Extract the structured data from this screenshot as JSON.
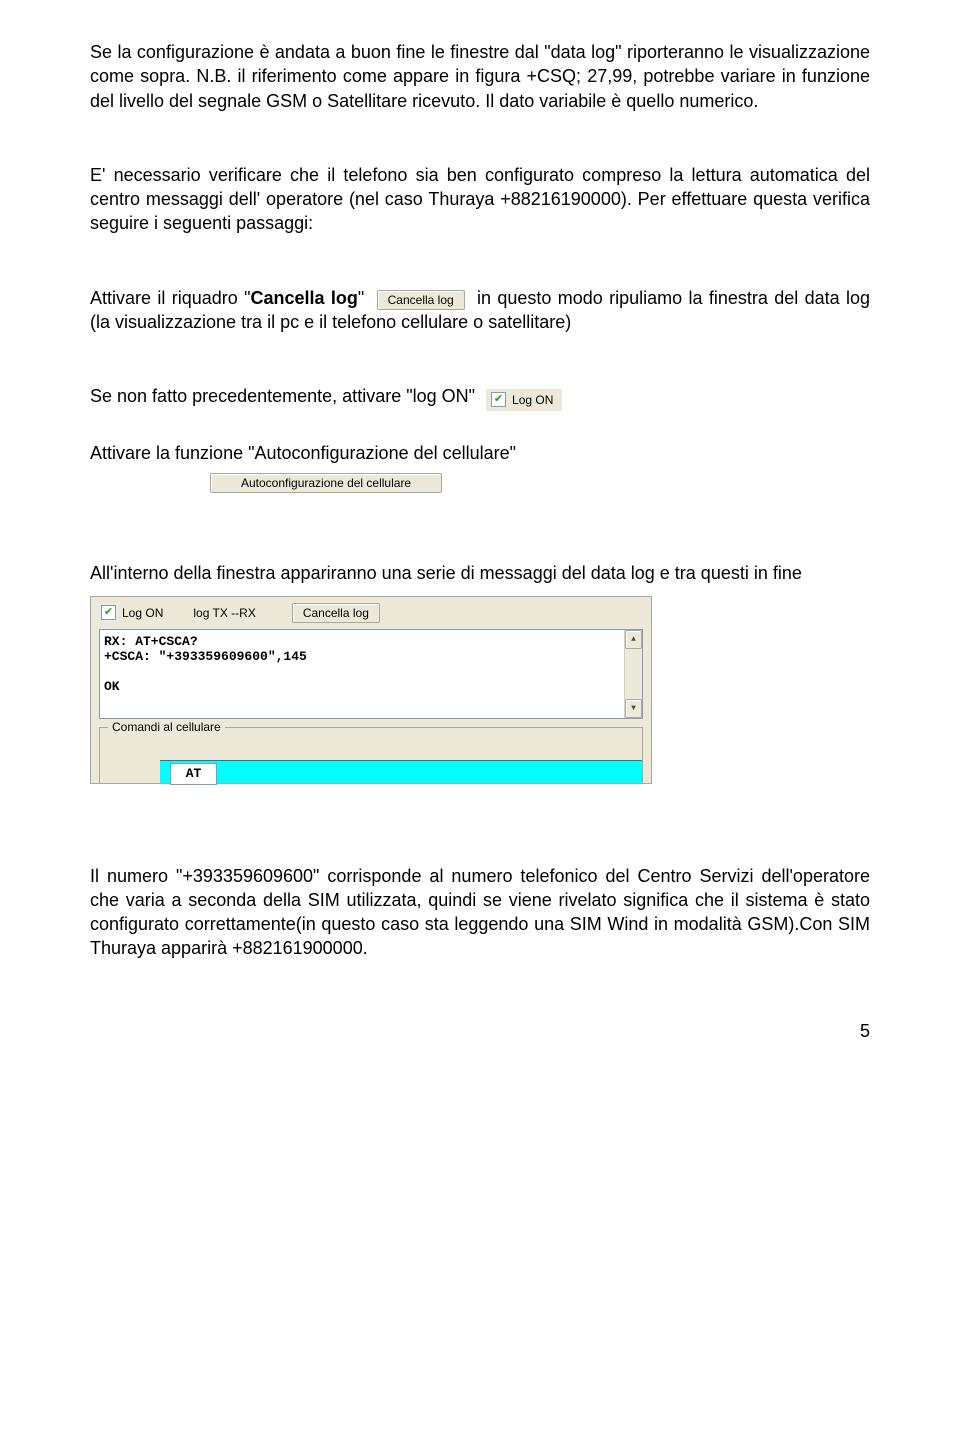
{
  "para1": "Se la configurazione è andata a buon fine le finestre dal \"data log\" riporteranno le visualizzazione come sopra. N.B. il riferimento come appare in figura +CSQ; 27,99, potrebbe variare in funzione del livello del segnale GSM o Satellitare ricevuto. Il dato variabile è quello numerico.",
  "para2": "E' necessario verificare che il telefono sia ben configurato compreso la lettura automatica del centro messaggi dell' operatore (nel caso Thuraya +88216190000). Per effettuare questa verifica seguire i seguenti passaggi:",
  "cancella": {
    "pre": "Attivare il riquadro \"",
    "bold": "Cancella log",
    "post_quote": "\" ",
    "btn": "Cancella log",
    "after": " in questo modo ripuliamo la finestra del data log (la visualizzazione tra  il pc e il telefono cellulare o satellitare)"
  },
  "logon": {
    "pre": "Se non fatto precedentemente, attivare \"log ON\" ",
    "label": "Log ON"
  },
  "autoconfig": {
    "pre": "Attivare la funzione \"Autoconfigurazione del cellulare\"",
    "btn": "Autoconfigurazione del cellulare"
  },
  "para_msg": "All'interno della finestra appariranno una serie di messaggi del data log e tra questi in fine",
  "panel": {
    "logon": "Log ON",
    "logtxrx": "log  TX --RX",
    "cancella": "Cancella log",
    "textarea": "RX: AT+CSCA?\n+CSCA: \"+393359609600\",145\n\nOK",
    "legend": "Comandi al cellulare",
    "at": "AT"
  },
  "para_last": "Il numero \"+393359609600\" corrisponde al numero telefonico del Centro Servizi dell'operatore che varia a seconda della SIM utilizzata, quindi se viene rivelato significa che il sistema è stato configurato correttamente(in questo caso sta leggendo una SIM Wind in modalità GSM).Con SIM Thuraya apparirà +882161900000.",
  "page_num": "5"
}
